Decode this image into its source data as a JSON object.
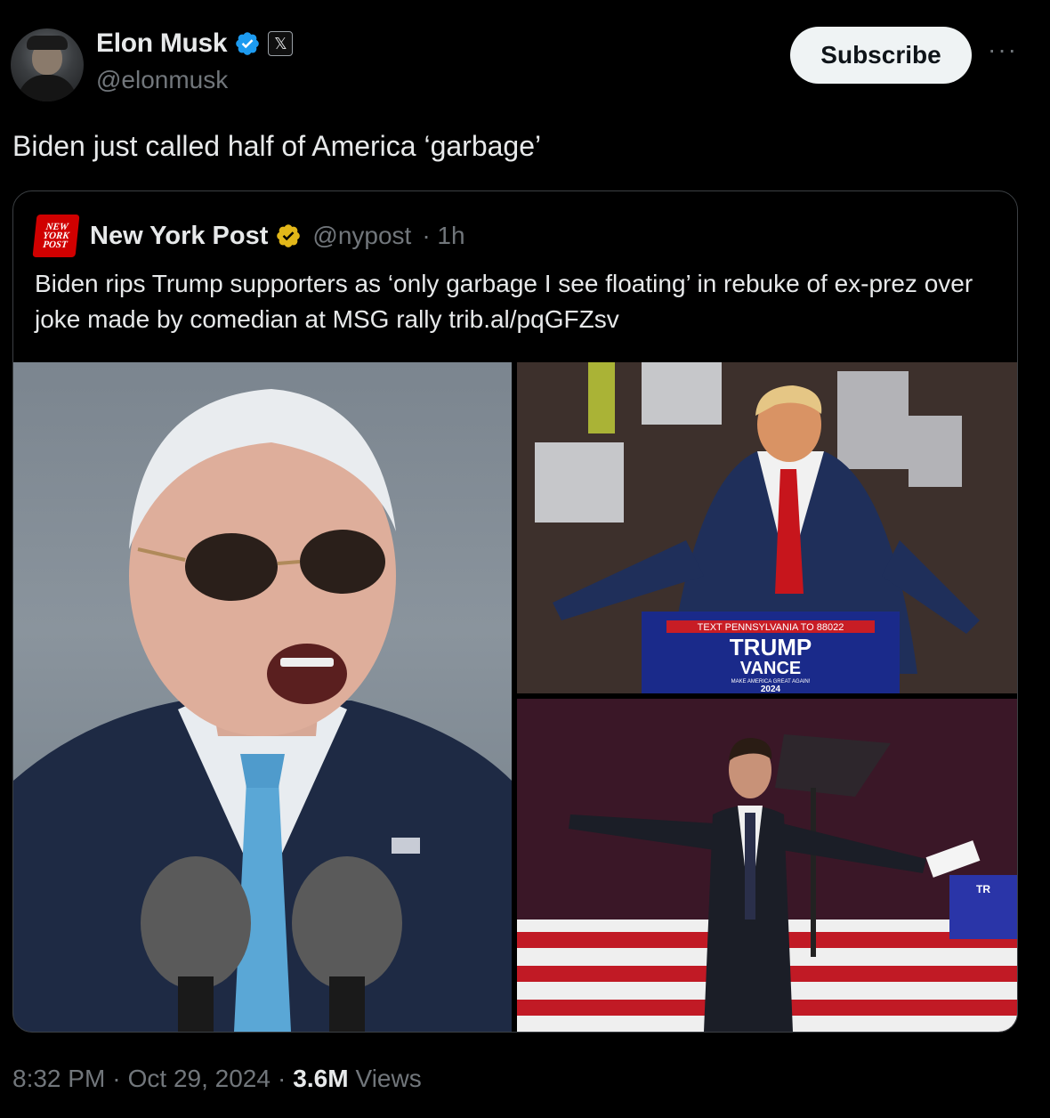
{
  "author": {
    "name": "Elon Musk",
    "handle": "@elonmusk",
    "badge_icon": "verified-badge",
    "affiliation_icon": "x-logo"
  },
  "actions": {
    "subscribe_label": "Subscribe",
    "more_label": "···"
  },
  "tweet": {
    "text": "Biden just called half of America ‘garbage’"
  },
  "quote": {
    "logo_lines": [
      "NEW",
      "YORK",
      "POST"
    ],
    "name": "New York Post",
    "handle": "@nypost",
    "time": "· 1h",
    "text": "Biden rips Trump supporters as ‘only garbage I see floating’ in rebuke of ex-prez over joke made by comedian at MSG rally trib.al/pqGFZsv",
    "media": {
      "sign_top": "TEXT PENNSYLVANIA TO 88022",
      "sign_line1": "TRUMP",
      "sign_line2": "VANCE",
      "sign_small": "MAKE AMERICA GREAT AGAIN!",
      "sign_year": "2024",
      "sign_partial": "TR"
    }
  },
  "meta": {
    "time": "8:32 PM",
    "date": "Oct 29, 2024",
    "views_count": "3.6M",
    "views_label": "Views"
  },
  "colors": {
    "background": "#000000",
    "text": "#e7e9ea",
    "secondary": "#71767b",
    "verified_blue": "#1d9bf0",
    "verified_gold": "#e2b719",
    "nyp_red": "#d00000"
  }
}
